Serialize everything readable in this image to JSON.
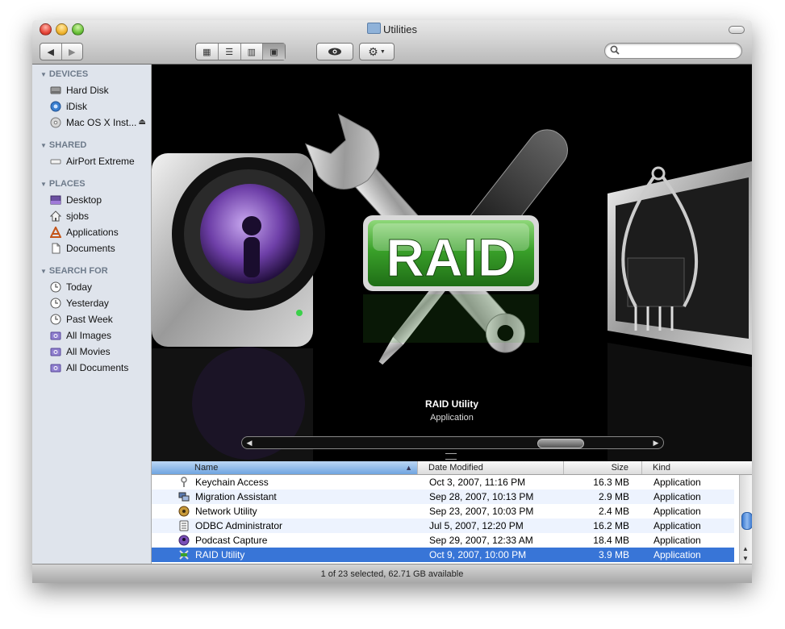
{
  "window": {
    "title": "Utilities"
  },
  "toolbar": {
    "back_icon": "back-arrow-icon",
    "forward_icon": "forward-arrow-icon",
    "view_modes": [
      "icon-view",
      "list-view",
      "column-view",
      "coverflow-view"
    ],
    "quicklook_icon": "eye-icon",
    "action_icon": "gear-icon",
    "search_placeholder": ""
  },
  "sidebar": {
    "sections": [
      {
        "title": "DEVICES",
        "items": [
          {
            "label": "Hard Disk",
            "icon": "hard-disk-icon"
          },
          {
            "label": "iDisk",
            "icon": "idisk-icon"
          },
          {
            "label": "Mac OS X Inst...",
            "icon": "dvd-icon",
            "eject": "⏏"
          }
        ]
      },
      {
        "title": "SHARED",
        "items": [
          {
            "label": "AirPort Extreme",
            "icon": "network-device-icon"
          }
        ]
      },
      {
        "title": "PLACES",
        "items": [
          {
            "label": "Desktop",
            "icon": "desktop-icon"
          },
          {
            "label": "sjobs",
            "icon": "home-icon"
          },
          {
            "label": "Applications",
            "icon": "applications-icon"
          },
          {
            "label": "Documents",
            "icon": "documents-icon"
          }
        ]
      },
      {
        "title": "SEARCH FOR",
        "items": [
          {
            "label": "Today",
            "icon": "clock-icon"
          },
          {
            "label": "Yesterday",
            "icon": "clock-icon"
          },
          {
            "label": "Past Week",
            "icon": "clock-icon"
          },
          {
            "label": "All Images",
            "icon": "smart-folder-icon"
          },
          {
            "label": "All Movies",
            "icon": "smart-folder-icon"
          },
          {
            "label": "All Documents",
            "icon": "smart-folder-icon"
          }
        ]
      }
    ]
  },
  "coverflow": {
    "selected_title": "RAID Utility",
    "selected_kind": "Application",
    "badge_text": "RAID"
  },
  "list": {
    "columns": {
      "name": "Name",
      "date": "Date Modified",
      "size": "Size",
      "kind": "Kind"
    },
    "rows": [
      {
        "name": "Keychain Access",
        "date": "Oct 3, 2007, 11:16 PM",
        "size": "16.3 MB",
        "kind": "Application",
        "icon": "keychain-icon",
        "selected": false
      },
      {
        "name": "Migration Assistant",
        "date": "Sep 28, 2007, 10:13 PM",
        "size": "2.9 MB",
        "kind": "Application",
        "icon": "migration-icon",
        "selected": false
      },
      {
        "name": "Network Utility",
        "date": "Sep 23, 2007, 10:03 PM",
        "size": "2.4 MB",
        "kind": "Application",
        "icon": "network-utility-icon",
        "selected": false
      },
      {
        "name": "ODBC Administrator",
        "date": "Jul 5, 2007, 12:20 PM",
        "size": "16.2 MB",
        "kind": "Application",
        "icon": "odbc-icon",
        "selected": false
      },
      {
        "name": "Podcast Capture",
        "date": "Sep 29, 2007, 12:33 AM",
        "size": "18.4 MB",
        "kind": "Application",
        "icon": "podcast-icon",
        "selected": false
      },
      {
        "name": "RAID Utility",
        "date": "Oct 9, 2007, 10:00 PM",
        "size": "3.9 MB",
        "kind": "Application",
        "icon": "raid-icon",
        "selected": true
      }
    ]
  },
  "status": {
    "text": "1 of 23 selected, 62.71 GB available"
  },
  "colors": {
    "selection": "#3875d7",
    "sidebar_bg": "#dfe4ec",
    "raid_green": "#3a9a2c"
  }
}
